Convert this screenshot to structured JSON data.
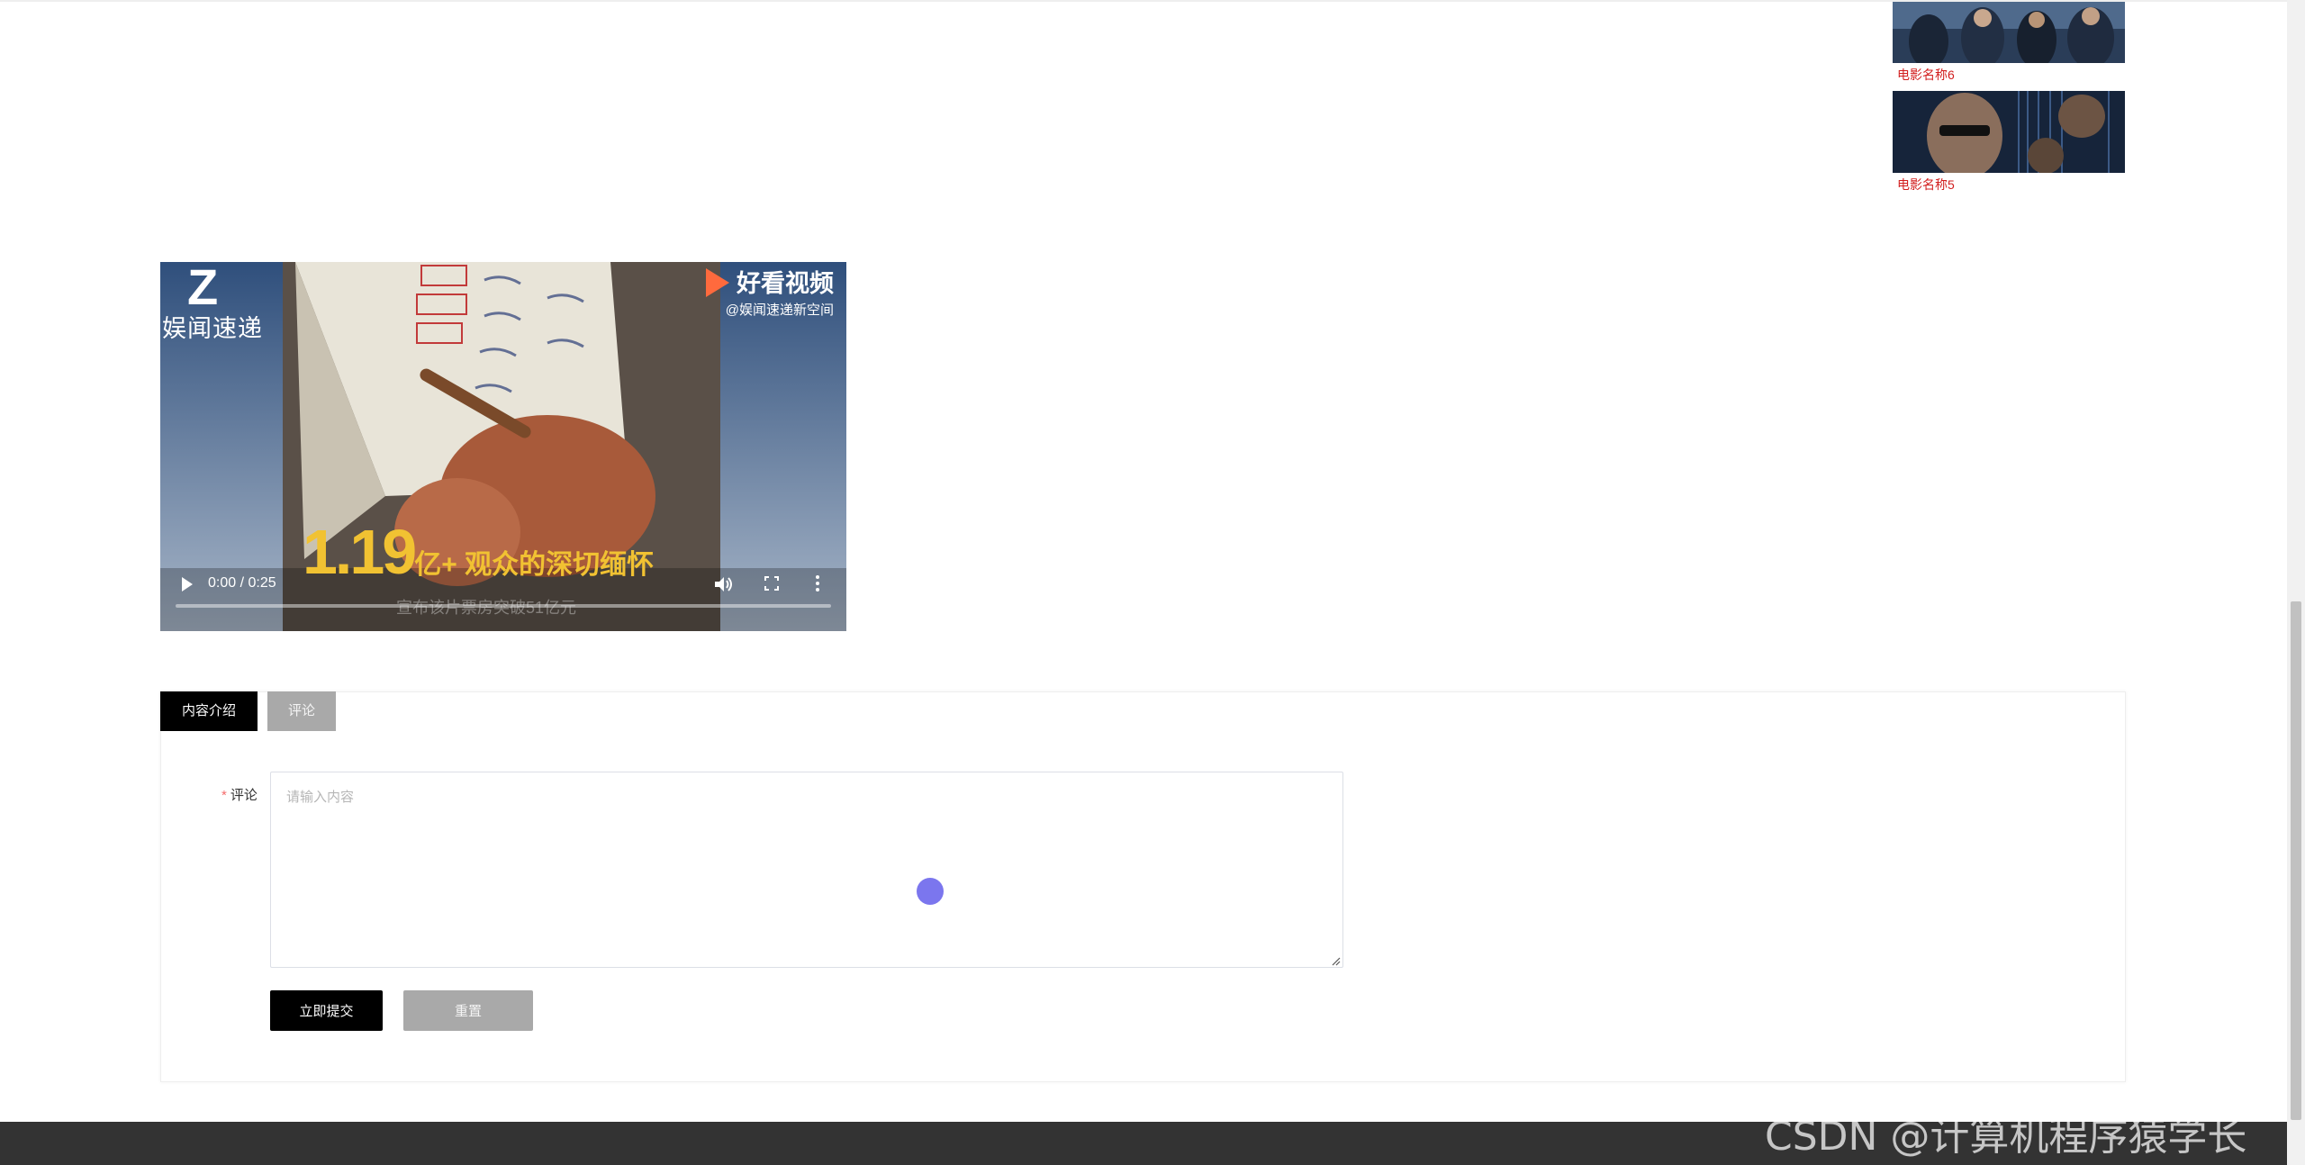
{
  "sidebar": {
    "movies": [
      {
        "name": "电影名称6",
        "thumb_colors": [
          "#1c2c44",
          "#3d5676",
          "#8fa6c2"
        ]
      },
      {
        "name": "电影名称5",
        "thumb_colors": [
          "#0f1c2c",
          "#3a4a5e",
          "#b89c86"
        ]
      }
    ]
  },
  "video": {
    "watermark_left_logo": "Z",
    "watermark_left_name": "娱闻速递",
    "watermark_right_brand": "好看视频",
    "watermark_right_handle": "@娱闻速递新空间",
    "caption_number": "1.19",
    "caption_text": "亿+ 观众的深切缅怀",
    "sub_caption": "宣布该片票房突破51亿元",
    "time": "0:00 / 0:25",
    "progress": 0
  },
  "tabs": [
    {
      "label": "内容介绍",
      "active": true
    },
    {
      "label": "评论",
      "active": false
    }
  ],
  "form": {
    "required_mark": "*",
    "label": "评论",
    "placeholder": "请输入内容",
    "value": "",
    "submit_label": "立即提交",
    "reset_label": "重置"
  },
  "watermark": "CSDN @计算机程序猿学长",
  "colors": {
    "accent": "#000000",
    "movie_name": "#d21e1e",
    "footer": "#333333",
    "inactive_tab": "#a9a9a9",
    "cursor_dot": "#7b76ee"
  }
}
